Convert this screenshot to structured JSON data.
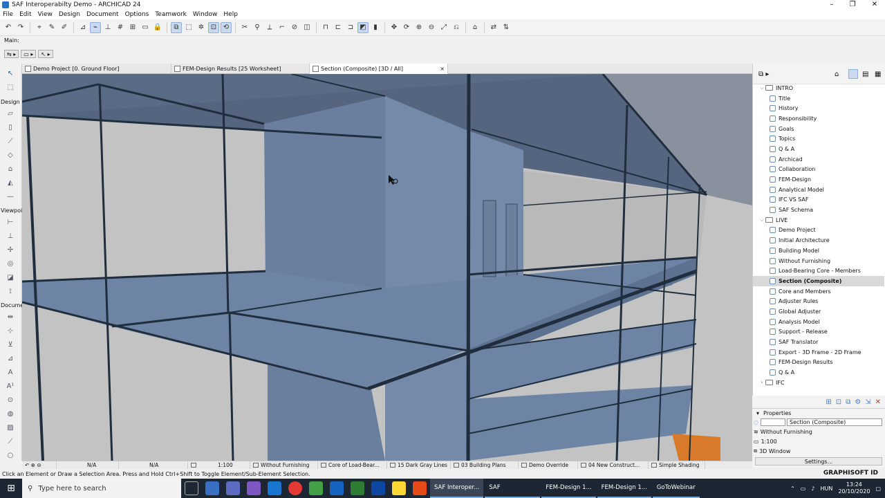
{
  "window": {
    "title": "SAF Interoperabilty Demo - ARCHICAD 24"
  },
  "menu": [
    "File",
    "Edit",
    "View",
    "Design",
    "Document",
    "Options",
    "Teamwork",
    "Window",
    "Help"
  ],
  "toolbar": {
    "main_label": "Main:"
  },
  "toolbox": {
    "groups": [
      "Design",
      "Viewpoi",
      "Docume"
    ]
  },
  "tabs": [
    {
      "label": "Demo Project [0. Ground Floor]"
    },
    {
      "label": "FEM-Design Results [25 Worksheet]"
    },
    {
      "label": "Section (Composite) [3D / All]",
      "close": "×"
    }
  ],
  "navigator": {
    "items": [
      {
        "label": "INTRO",
        "level": 0,
        "type": "folder",
        "arrow": "⌵"
      },
      {
        "label": "Title",
        "level": 1,
        "type": "page"
      },
      {
        "label": "History",
        "level": 1,
        "type": "page"
      },
      {
        "label": "Responsibility",
        "level": 1,
        "type": "page"
      },
      {
        "label": "Goals",
        "level": 1,
        "type": "page"
      },
      {
        "label": "Topics",
        "level": 1,
        "type": "page"
      },
      {
        "label": "Q & A",
        "level": 1,
        "type": "page"
      },
      {
        "label": "Archicad",
        "level": 1,
        "type": "page"
      },
      {
        "label": "Collaboration",
        "level": 1,
        "type": "page"
      },
      {
        "label": "FEM-Design",
        "level": 1,
        "type": "page"
      },
      {
        "label": "Analytical Model",
        "level": 1,
        "type": "page"
      },
      {
        "label": "IFC VS SAF",
        "level": 1,
        "type": "page"
      },
      {
        "label": "SAF Schema",
        "level": 1,
        "type": "page"
      },
      {
        "label": "LIVE",
        "level": 0,
        "type": "folder",
        "arrow": "⌵"
      },
      {
        "label": "Demo Project",
        "level": 1,
        "type": "page"
      },
      {
        "label": "Initial Architecture",
        "level": 1,
        "type": "page"
      },
      {
        "label": "Building Model",
        "level": 1,
        "type": "page"
      },
      {
        "label": "Without Furnishing",
        "level": 1,
        "type": "page"
      },
      {
        "label": "Load-Bearing Core - Members",
        "level": 1,
        "type": "page"
      },
      {
        "label": "Section (Composite)",
        "level": 1,
        "type": "page",
        "selected": true
      },
      {
        "label": "Core and Members",
        "level": 1,
        "type": "page"
      },
      {
        "label": "Adjuster Rules",
        "level": 1,
        "type": "page"
      },
      {
        "label": "Global Adjuster",
        "level": 1,
        "type": "page"
      },
      {
        "label": "Analysis Model",
        "level": 1,
        "type": "page"
      },
      {
        "label": "Support - Release",
        "level": 1,
        "type": "page"
      },
      {
        "label": "SAF Translator",
        "level": 1,
        "type": "page"
      },
      {
        "label": "Export - 3D Frame - 2D Frame",
        "level": 1,
        "type": "page"
      },
      {
        "label": "FEM-Design Results",
        "level": 1,
        "type": "page"
      },
      {
        "label": "Q & A",
        "level": 1,
        "type": "page"
      },
      {
        "label": "IFC",
        "level": 0,
        "type": "folder",
        "arrow": "›"
      }
    ]
  },
  "properties": {
    "header": "Properties",
    "name": "Section (Composite)",
    "layer_combo": "Without Furnishing",
    "scale": "1:100",
    "window_type": "3D Window",
    "settings_button": "Settings..."
  },
  "quickbar": {
    "na1": "N/A",
    "na2": "N/A",
    "scale": "1:100",
    "layer": "Without Furnishing",
    "mvo": "Core of Load-Bear...",
    "pen": "15 Dark Gray Lines",
    "model_view": "03 Building Plans",
    "override": "Demo Override",
    "renovation": "04 New Construct...",
    "shading": "Simple Shading"
  },
  "status": {
    "message": "Click an Element or Draw a Selection Area. Press and Hold Ctrl+Shift to Toggle Element/Sub-Element Selection.",
    "brand": "GRAPHISOFT ID"
  },
  "taskbar": {
    "search_placeholder": "Type here to search",
    "buttons": [
      "SAF Interoper...",
      "SAF",
      "FEM-Design 1...",
      "FEM-Design 1...",
      "GoToWebinar"
    ],
    "lang": "HUN",
    "time": "13:24",
    "date": "20/10/2020"
  },
  "colors": {
    "accent": "#4a7cc7",
    "viewport_bg": "#bdbdbd",
    "slab": "#6f85a5",
    "frame": "#1f2d3d",
    "taskbar": "#1d2734"
  }
}
